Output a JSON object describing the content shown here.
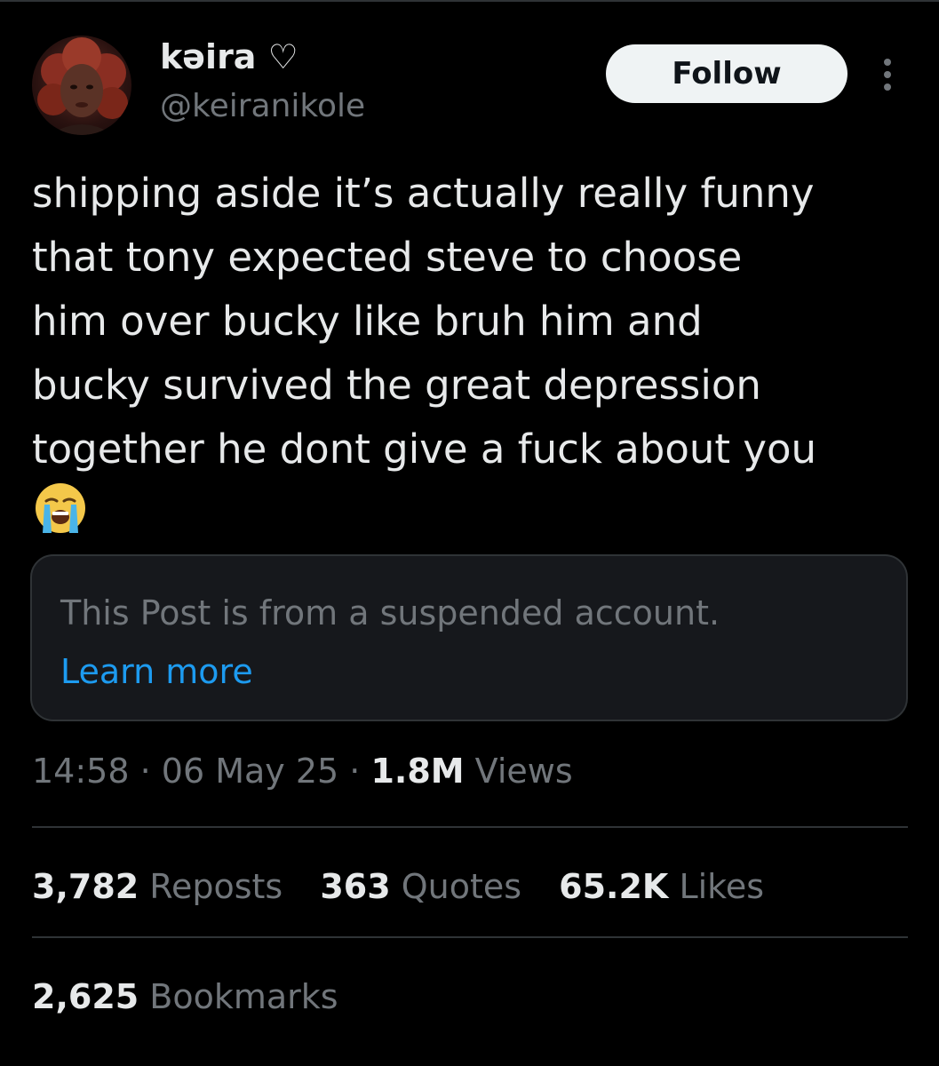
{
  "author": {
    "display_name": "kəira ♡",
    "handle": "@keiranikole"
  },
  "actions": {
    "follow_label": "Follow"
  },
  "post": {
    "lines": [
      "shipping aside it’s actually really funny",
      "that tony expected steve to choose",
      "him over bucky like bruh him and",
      "bucky survived the great depression",
      "together he dont give a fuck about you"
    ],
    "emoji": "loudly-crying-face"
  },
  "notice": {
    "text": "This Post is from a suspended account.",
    "link_label": "Learn more"
  },
  "meta": {
    "time": "14:58",
    "separator": " · ",
    "date": "06 May 25",
    "views_count": "1.8M",
    "views_label": " Views"
  },
  "stats": {
    "reposts_count": "3,782",
    "reposts_label": " Reposts",
    "quotes_count": "363",
    "quotes_label": " Quotes",
    "likes_count": "65.2K",
    "likes_label": " Likes",
    "bookmarks_count": "2,625",
    "bookmarks_label": " Bookmarks"
  },
  "colors": {
    "background": "#000000",
    "text_primary": "#e7e9ea",
    "text_secondary": "#71767b",
    "link": "#1d9bf0",
    "divider": "#2f3336",
    "notice_background": "#16181c",
    "follow_button_bg": "#eff3f4"
  }
}
